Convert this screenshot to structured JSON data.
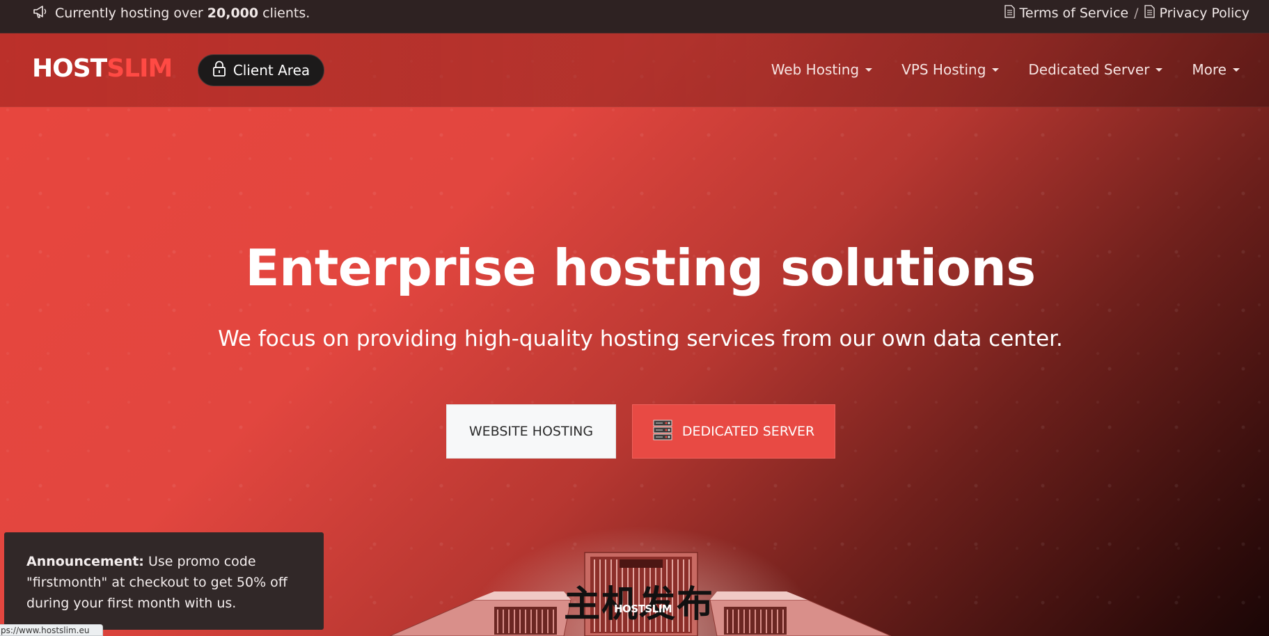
{
  "topbar": {
    "announce_prefix": "Currently hosting over ",
    "announce_count": "20,000",
    "announce_suffix": " clients.",
    "terms_label": "Terms of Service",
    "separator": "/",
    "privacy_label": "Privacy Policy"
  },
  "navbar": {
    "logo_host": "HOST",
    "logo_slim": "SLIM",
    "client_area_label": "Client Area",
    "menu": [
      {
        "label": "Web Hosting"
      },
      {
        "label": "VPS Hosting"
      },
      {
        "label": "Dedicated Server"
      },
      {
        "label": "More"
      }
    ]
  },
  "hero": {
    "headline": "Enterprise hosting solutions",
    "subline": "We focus on providing high-quality hosting services from our own data center.",
    "cta_hosting": "WEBSITE HOSTING",
    "cta_dedicated": "DEDICATED SERVER"
  },
  "illustration": {
    "overlay_text": "主机发布",
    "server_logo": "HOSTSLIM"
  },
  "toast": {
    "title": "Announcement:",
    "body": " Use promo code \"firstmonth\" at checkout to get 50% off during your first month with us."
  },
  "status_bar": {
    "url": "ps://www.hostslim.eu"
  },
  "colors": {
    "brand_red": "#e84a44",
    "topbar_bg": "#2e2222",
    "toast_bg": "#312828"
  },
  "icons": {
    "announce": "megaphone-icon",
    "terms": "document-icon",
    "privacy": "document-icon",
    "client_area": "lock-icon",
    "dedicated": "server-rack-icon"
  }
}
